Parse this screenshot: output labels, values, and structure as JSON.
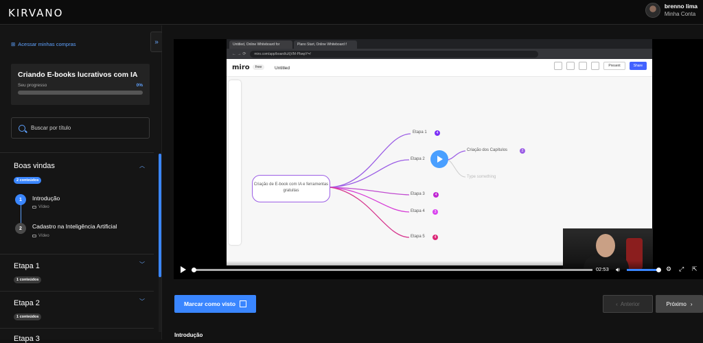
{
  "brand": {
    "logo": "KIRVANO"
  },
  "user": {
    "name": "brenno lima",
    "sub": "Minha Conta"
  },
  "sidebar": {
    "access_link": "Acessar minhas compras",
    "course": {
      "title": "Criando E-books lucrativos com IA",
      "progress_label": "Seu progresso",
      "progress_pct": "0%",
      "progress_value": 0
    },
    "search_placeholder": "Buscar por título",
    "sections": [
      {
        "title": "Boas vindas",
        "badge": "2 conteúdos",
        "lessons": [
          {
            "num": "1",
            "title": "Introdução",
            "type": "Vídeo"
          },
          {
            "num": "2",
            "title": "Cadastro na Inteligência Artificial",
            "type": "Vídeo"
          }
        ]
      },
      {
        "title": "Etapa 1",
        "badge": "1 conteúdos"
      },
      {
        "title": "Etapa 2",
        "badge": "1 conteúdos"
      },
      {
        "title": "Etapa 3"
      }
    ]
  },
  "browser": {
    "tabs": [
      "Untitled, Online Whiteboard for",
      "Plano Start, Online Whiteboard f"
    ],
    "url": "miro.com/app/board/uXjVM-PbwpY=/"
  },
  "miro": {
    "logo": "miro",
    "free": "free",
    "board": "Untitled",
    "present": "Present",
    "share": "Share"
  },
  "mindmap": {
    "central": "Criação de E-book com IA e ferramentas gratuitas",
    "nodes": [
      {
        "label": "Etapa 1",
        "count": "4"
      },
      {
        "label": "Etapa 2",
        "count": ""
      },
      {
        "label": "Etapa 3",
        "count": "4"
      },
      {
        "label": "Etapa 4",
        "count": "3"
      },
      {
        "label": "Etapa 5",
        "count": "4"
      }
    ],
    "child": {
      "label": "Criação dos Capítulos",
      "count": "2"
    },
    "placeholder": "Type something"
  },
  "player": {
    "time": "02:53"
  },
  "actions": {
    "mark": "Marcar como visto",
    "prev": "Anterior",
    "next": "Próximo"
  },
  "lesson_heading": "Introdução",
  "colors": {
    "accent": "#3a86ff",
    "purple": "#9b5de5",
    "magenta": "#d63ad6"
  }
}
